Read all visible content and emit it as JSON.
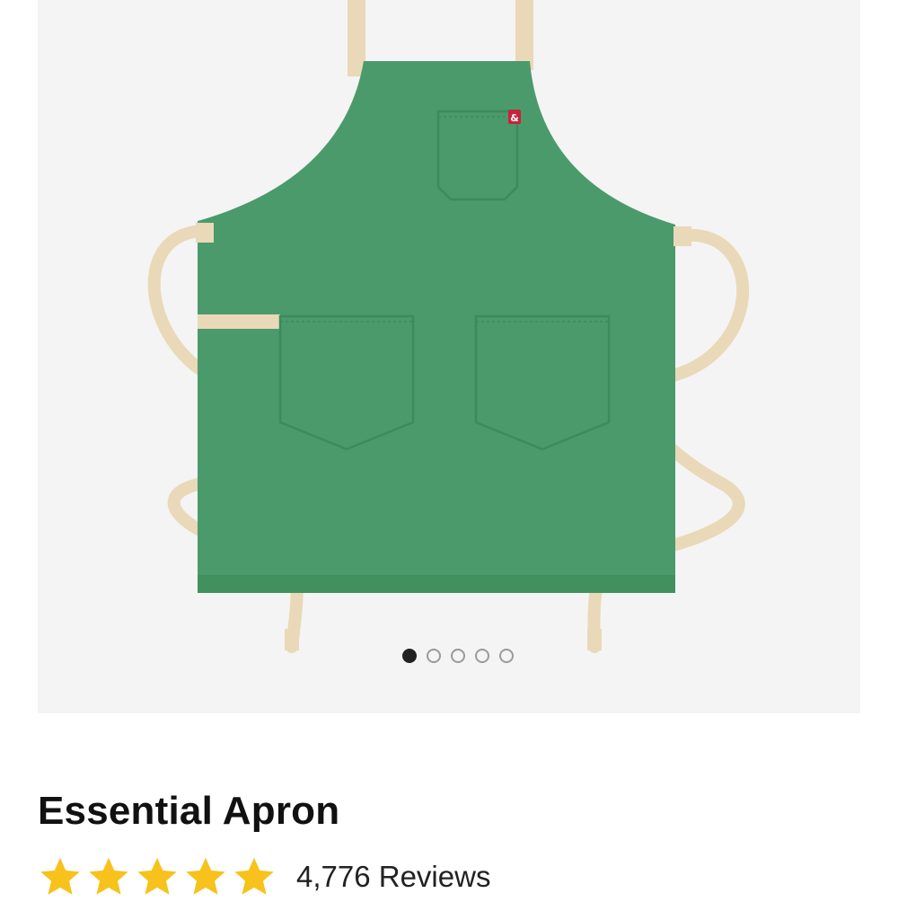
{
  "product": {
    "image_alt": "Green canvas apron with tan cotton straps and three pockets",
    "title": "Essential Apron",
    "rating": 5,
    "reviews_label": "4,776 Reviews"
  },
  "gallery": {
    "image_count": 5,
    "active_index": 0
  },
  "colors": {
    "apron": "#4b9a6c",
    "straps": "#e9d9b8",
    "background": "#f4f4f4",
    "star": "#f7c21b",
    "logo_tag": "#c8233b"
  },
  "icons": {
    "star": "star-icon",
    "logo": "ampersand-logo"
  },
  "logo_text": "&"
}
